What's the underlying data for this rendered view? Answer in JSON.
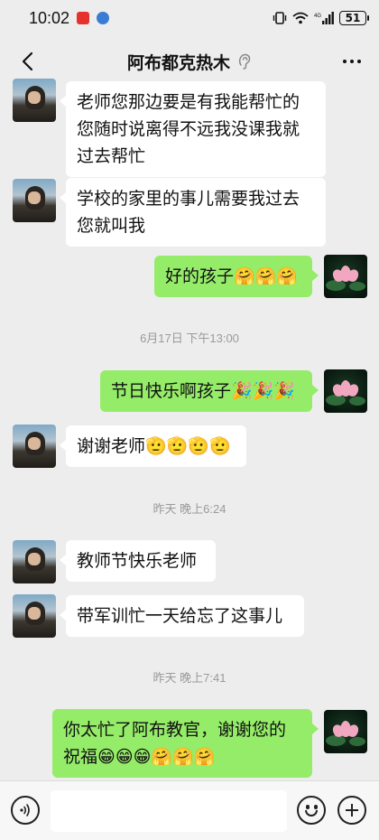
{
  "status_bar": {
    "time": "10:02",
    "battery": "51"
  },
  "header": {
    "title": "阿布都克热木",
    "back_icon": "chevron-left-icon",
    "more_icon": "more-icon",
    "ear_icon": "ear-icon"
  },
  "messages": [
    {
      "side": "left",
      "text_lines": [
        "老师您那边要是有我能帮忙的",
        "您随时说离得不远我没课我就",
        "过去帮忙"
      ]
    },
    {
      "side": "left",
      "text_lines": [
        "学校的家里的事儿需要我过去",
        "您就叫我"
      ]
    },
    {
      "side": "right",
      "text": "好的孩子",
      "emoji": "🤗🤗🤗"
    },
    {
      "type": "timestamp",
      "text": "6月17日 下午13:00"
    },
    {
      "side": "right",
      "text": "节日快乐啊孩子",
      "emoji": "🎉🎉🎉"
    },
    {
      "side": "left",
      "text": "谢谢老师",
      "emoji": "🫡🫡🫡🫡"
    },
    {
      "type": "timestamp",
      "text": "昨天 晚上6:24"
    },
    {
      "side": "left",
      "text": "教师节快乐老师"
    },
    {
      "side": "left",
      "text": "带军训忙一天给忘了这事儿"
    },
    {
      "type": "timestamp",
      "text": "昨天 晚上7:41"
    },
    {
      "side": "right",
      "text_lines": [
        "你太忙了阿布教官，谢谢您的",
        "祝福"
      ],
      "emoji": "😁😁😁🤗🤗🤗"
    }
  ],
  "input_bar": {
    "voice_icon": "voice-icon",
    "emoji_icon": "emoji-icon",
    "plus_icon": "plus-icon",
    "placeholder": ""
  }
}
